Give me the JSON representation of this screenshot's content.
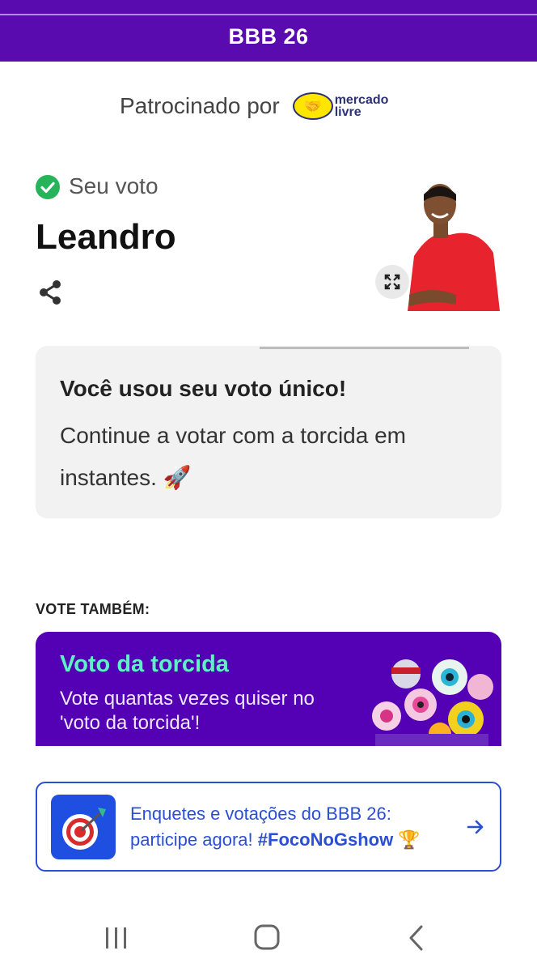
{
  "header": {
    "title": "BBB 26"
  },
  "sponsor": {
    "text": "Patrocinado por",
    "logo_word_1": "mercado",
    "logo_word_2": "livre"
  },
  "vote": {
    "status_label": "Seu voto",
    "candidate_name": "Leandro"
  },
  "info_card": {
    "title": "Você usou seu voto único!",
    "body": "Continue a votar com a torcida em instantes.",
    "emoji": "🚀"
  },
  "vote_also": {
    "label": "VOTE TAMBÉM:"
  },
  "torcida_card": {
    "title": "Voto da torcida",
    "text": "Vote quantas vezes quiser no 'voto da torcida'!"
  },
  "promo": {
    "text": "Enquetes e votações do BBB 26: participe agora!",
    "hashtag": "#FocoNoGshow",
    "emoji": "🏆"
  },
  "colors": {
    "header": "#5a0bb0",
    "torcida_bg": "#5400b4",
    "torcida_title": "#5ff0c8",
    "check": "#27b35a",
    "promo_blue": "#2a4fd4"
  },
  "icons": [
    "check-icon",
    "share-icon",
    "expand-icon",
    "target-icon",
    "arrow-right-icon",
    "recent-apps-icon",
    "home-icon",
    "back-icon"
  ]
}
